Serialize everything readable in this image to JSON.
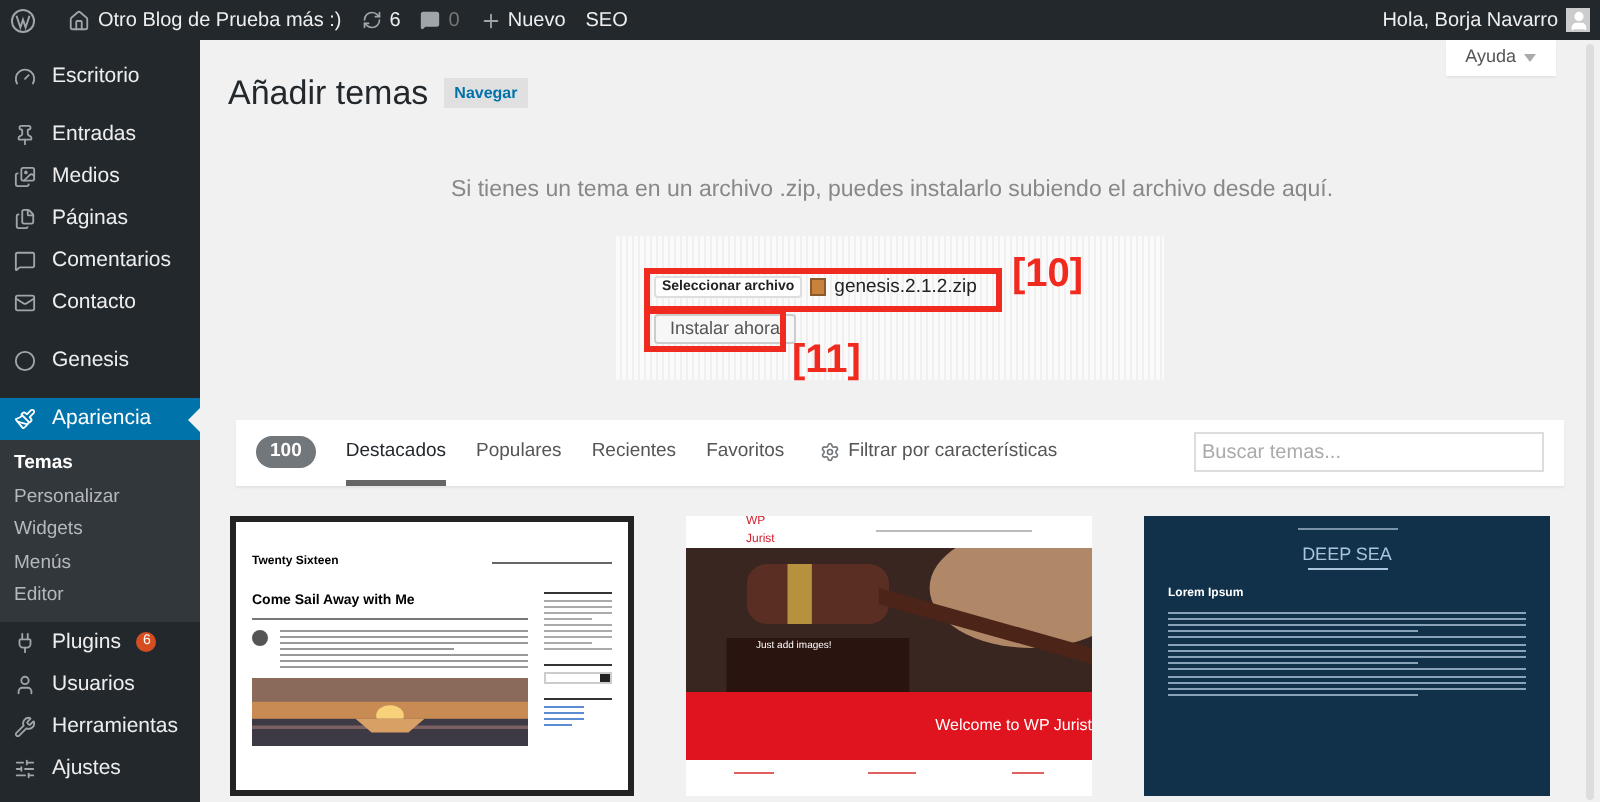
{
  "admin_bar": {
    "site_title": "Otro Blog de Prueba más :)",
    "updates": "6",
    "comments": "0",
    "new_label": "Nuevo",
    "seo_label": "SEO",
    "greeting": "Hola, Borja Navarro"
  },
  "sidebar": {
    "items": [
      {
        "label": "Escritorio",
        "selected": false,
        "group_end": true
      },
      {
        "label": "Entradas",
        "selected": false
      },
      {
        "label": "Medios",
        "selected": false
      },
      {
        "label": "Páginas",
        "selected": false
      },
      {
        "label": "Comentarios",
        "selected": false
      },
      {
        "label": "Contacto",
        "selected": false,
        "group_end": true
      },
      {
        "label": "Genesis",
        "selected": false,
        "group_end": true
      },
      {
        "label": "Apariencia",
        "selected": true,
        "children": [
          {
            "label": "Temas",
            "selected": true
          },
          {
            "label": "Personalizar",
            "selected": false
          },
          {
            "label": "Widgets",
            "selected": false
          },
          {
            "label": "Menús",
            "selected": false
          },
          {
            "label": "Editor",
            "selected": false
          }
        ]
      },
      {
        "label": "Plugins",
        "selected": false,
        "badge": "6"
      },
      {
        "label": "Usuarios",
        "selected": false
      },
      {
        "label": "Herramientas",
        "selected": false
      },
      {
        "label": "Ajustes",
        "selected": false
      }
    ]
  },
  "help_tab": "Ayuda",
  "page": {
    "title": "Añadir temas",
    "browse_button": "Navegar"
  },
  "upload": {
    "description": "Si tienes un tema en un archivo .zip, puedes instalarlo subiendo el archivo desde aquí.",
    "choose_button": "Seleccionar archivo",
    "file_name": "genesis.2.1.2.zip",
    "install_button": "Instalar ahora",
    "annotations": [
      "[10]",
      "[11]"
    ]
  },
  "filter_bar": {
    "count": "100",
    "tabs": [
      {
        "label": "Destacados",
        "selected": true
      },
      {
        "label": "Populares",
        "selected": false
      },
      {
        "label": "Recientes",
        "selected": false
      },
      {
        "label": "Favoritos",
        "selected": false
      }
    ],
    "feature_filter": "Filtrar por características",
    "search": {
      "placeholder": "Buscar temas..."
    }
  },
  "themes": [
    {
      "kind": "blog",
      "site_title": "Twenty Sixteen",
      "post_title": "Come Sail Away with Me"
    },
    {
      "kind": "law",
      "site_title": "WP Jurist",
      "hero_title": "Just add images!",
      "welcome": "Welcome to WP Jurist"
    },
    {
      "kind": "dark",
      "site_title": "DEEP SEA",
      "post_title": "Lorem Ipsum"
    }
  ]
}
